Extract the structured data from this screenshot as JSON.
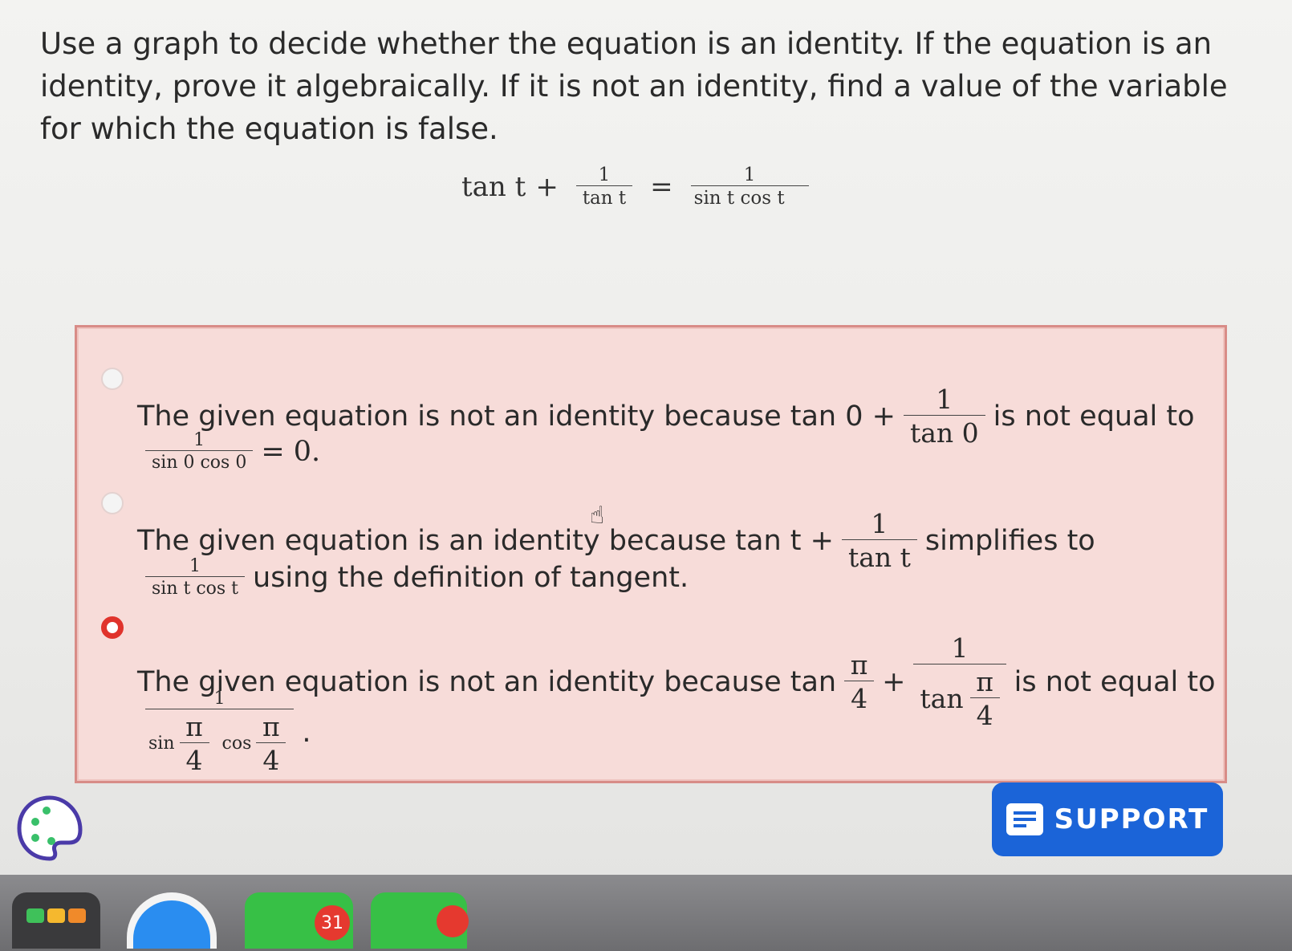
{
  "question": {
    "text": "Use a graph to decide whether the equation is an identity. If the equation is an identity, prove it algebraically. If it is not an identity, find a value of the variable for which the equation is false.",
    "equation": {
      "left_term": "tan t",
      "plus": "+",
      "left_frac_num": "1",
      "left_frac_den": "tan t",
      "equals": "=",
      "right_frac_num": "1",
      "right_frac_den": "sin t  cos t"
    }
  },
  "options": [
    {
      "selected": false,
      "part1": "The given equation is not an identity because tan  0 +",
      "frac_num": "1",
      "frac_den": "tan  0",
      "part2": "is not equal to",
      "frac2_num": "1",
      "frac2_den": "sin  0  cos  0",
      "part3": "= 0."
    },
    {
      "selected": false,
      "part1": "The given equation is an identity because tan  t +",
      "frac_num": "1",
      "frac_den": "tan  t",
      "part2": "simplifies to",
      "frac2_num": "1",
      "frac2_den": "sin  t  cos  t",
      "part3": "using the definition of tangent."
    },
    {
      "selected": true,
      "part1": "The given equation is not an identity because tan",
      "pi_num": "π",
      "pi_den": "4",
      "plus": "+",
      "frac_num": "1",
      "frac_den": "tan",
      "part2": "is not equal to",
      "frac2_num": "1",
      "sin_label": "sin",
      "cos_label": "cos",
      "part3": "."
    }
  ],
  "support": {
    "label": "SUPPORT"
  },
  "dock": {
    "calendar_badge": "31"
  },
  "colors": {
    "accent": "#1b64d8",
    "selected_radio": "#e0332c",
    "answer_bg": "#f7dcd9"
  }
}
